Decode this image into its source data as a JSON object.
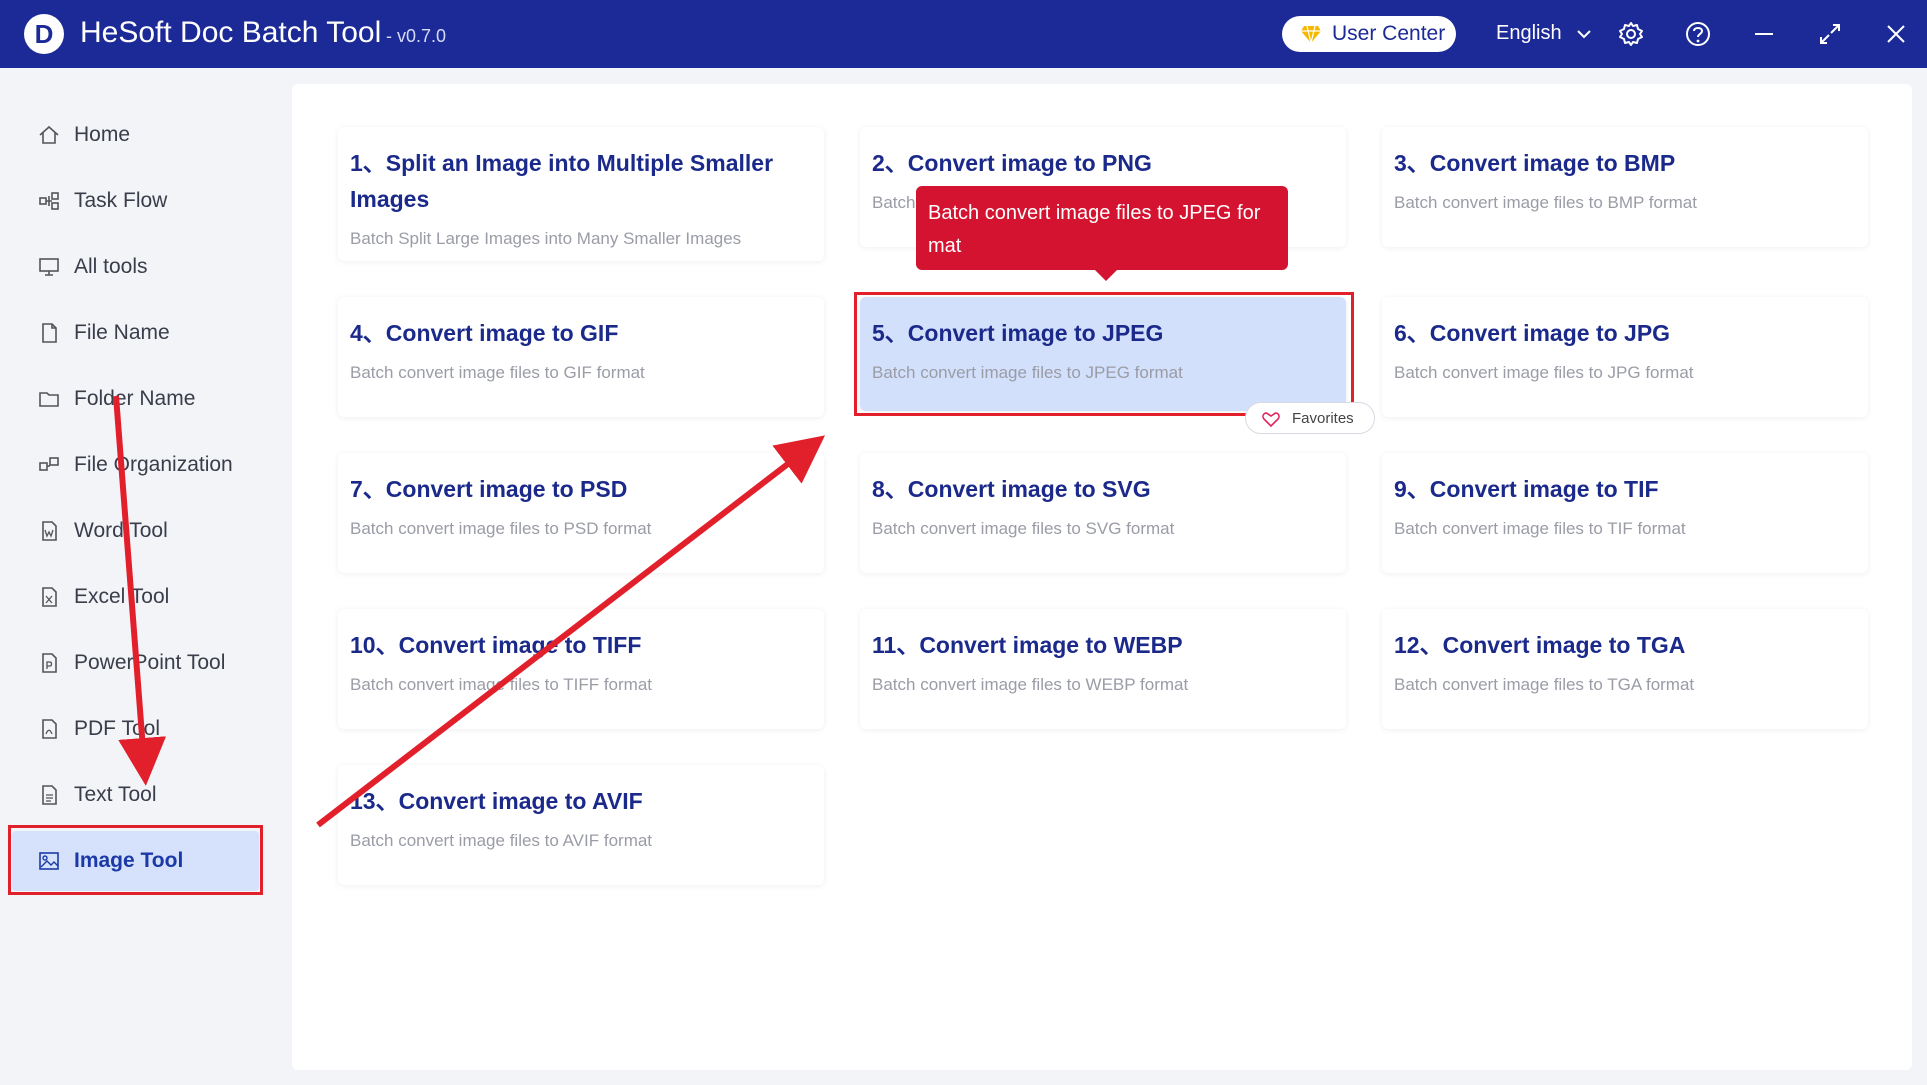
{
  "app": {
    "logo_letter": "D",
    "title": "HeSoft Doc Batch Tool",
    "version": "- v0.7.0"
  },
  "header": {
    "user_center_label": "User Center",
    "language": "English",
    "icons": [
      "diamond-icon",
      "chevron-down-icon",
      "gear-icon",
      "help-icon",
      "minimize-icon",
      "maximize-icon",
      "close-icon"
    ]
  },
  "sidebar": {
    "items": [
      {
        "label": "Home",
        "icon": "home-icon"
      },
      {
        "label": "Task Flow",
        "icon": "task-flow-icon"
      },
      {
        "label": "All tools",
        "icon": "monitor-icon"
      },
      {
        "label": "File Name",
        "icon": "file-icon"
      },
      {
        "label": "Folder Name",
        "icon": "folder-icon"
      },
      {
        "label": "File Organization",
        "icon": "organization-icon"
      },
      {
        "label": "Word Tool",
        "icon": "word-icon"
      },
      {
        "label": "Excel Tool",
        "icon": "excel-icon"
      },
      {
        "label": "PowerPoint Tool",
        "icon": "powerpoint-icon"
      },
      {
        "label": "PDF Tool",
        "icon": "pdf-icon"
      },
      {
        "label": "Text Tool",
        "icon": "text-icon"
      },
      {
        "label": "Image Tool",
        "icon": "image-icon",
        "active": true
      }
    ]
  },
  "tools": [
    {
      "title": "1、Split an Image into Multiple Smaller Images",
      "desc": "Batch Split Large Images into Many Smaller Images"
    },
    {
      "title": "2、Convert image to PNG",
      "desc": "Batch"
    },
    {
      "title": "3、Convert image to BMP",
      "desc": "Batch convert image files to BMP format"
    },
    {
      "title": "4、Convert image to GIF",
      "desc": "Batch convert image files to GIF format"
    },
    {
      "title": "5、Convert image to JPEG",
      "desc": "Batch convert image files to JPEG format",
      "selected": true
    },
    {
      "title": "6、Convert image to JPG",
      "desc": "Batch convert image files to JPG format"
    },
    {
      "title": "7、Convert image to PSD",
      "desc": "Batch convert image files to PSD format"
    },
    {
      "title": "8、Convert image to SVG",
      "desc": "Batch convert image files to SVG format"
    },
    {
      "title": "9、Convert image to TIF",
      "desc": "Batch convert image files to TIF format"
    },
    {
      "title": "10、Convert image to TIFF",
      "desc": "Batch convert image files to TIFF format"
    },
    {
      "title": "11、Convert image to WEBP",
      "desc": "Batch convert image files to WEBP format"
    },
    {
      "title": "12、Convert image to TGA",
      "desc": "Batch convert image files to TGA format"
    },
    {
      "title": "13、Convert image to AVIF",
      "desc": "Batch convert image files to AVIF format"
    }
  ],
  "tooltip": {
    "text": "Batch convert image files to JPEG for mat"
  },
  "favorites_label": "Favorites",
  "colors": {
    "header_bg": "#1b2a96",
    "accent": "#1b3aa8",
    "highlight_red": "#e2202b",
    "tooltip_bg": "#d31330",
    "selected_card": "#d3e0fb"
  }
}
